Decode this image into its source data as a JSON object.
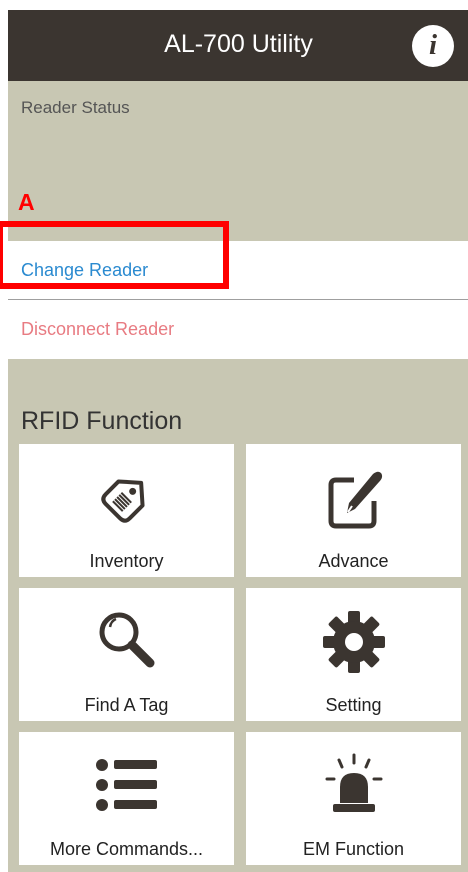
{
  "appbar": {
    "title": "AL-700 Utility",
    "info_icon": "info-icon"
  },
  "reader_status": {
    "label": "Reader Status"
  },
  "annotation": {
    "marker": "A",
    "color": "#ff0000"
  },
  "reader_actions": {
    "change": "Change Reader",
    "disconnect": "Disconnect Reader"
  },
  "rfid": {
    "title": "RFID Function",
    "tiles": [
      {
        "label": "Inventory",
        "icon": "tag-icon"
      },
      {
        "label": "Advance",
        "icon": "edit-icon"
      },
      {
        "label": "Find A Tag",
        "icon": "magnifier-icon"
      },
      {
        "label": "Setting",
        "icon": "gear-icon"
      },
      {
        "label": "More Commands...",
        "icon": "list-icon"
      },
      {
        "label": "EM Function",
        "icon": "alarm-light-icon"
      }
    ]
  },
  "colors": {
    "appbar": "#3b3530",
    "background": "#c8c7b3",
    "link_blue": "#2a8ad0",
    "link_red": "#e87b82",
    "icon": "#3b3530"
  }
}
